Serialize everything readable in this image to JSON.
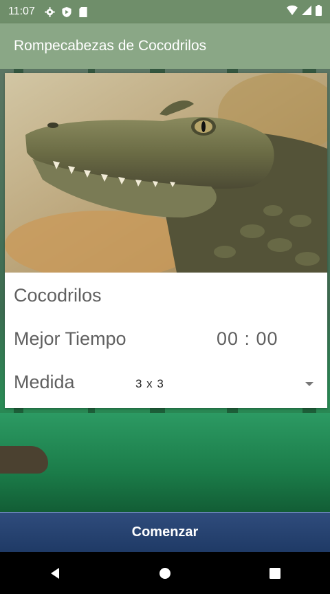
{
  "status_bar": {
    "time": "11:07",
    "icons": [
      "settings-icon",
      "shield-icon",
      "sd-card-icon"
    ],
    "right_icons": [
      "wifi-icon",
      "signal-icon",
      "battery-icon"
    ]
  },
  "app_bar": {
    "title": "Rompecabezas de Cocodrilos"
  },
  "card": {
    "name": "Cocodrilos",
    "best_time_label": "Mejor Tiempo",
    "best_time_value": "00 : 00",
    "size_label": "Medida",
    "size_selected": "3 x 3"
  },
  "start_button": {
    "label": "Comenzar"
  },
  "nav": {
    "buttons": [
      "back-icon",
      "home-icon",
      "recents-icon"
    ]
  },
  "colors": {
    "app_bar": "#8aa786",
    "status_bar": "#6f8e6a",
    "start_button": "#243f6e"
  }
}
